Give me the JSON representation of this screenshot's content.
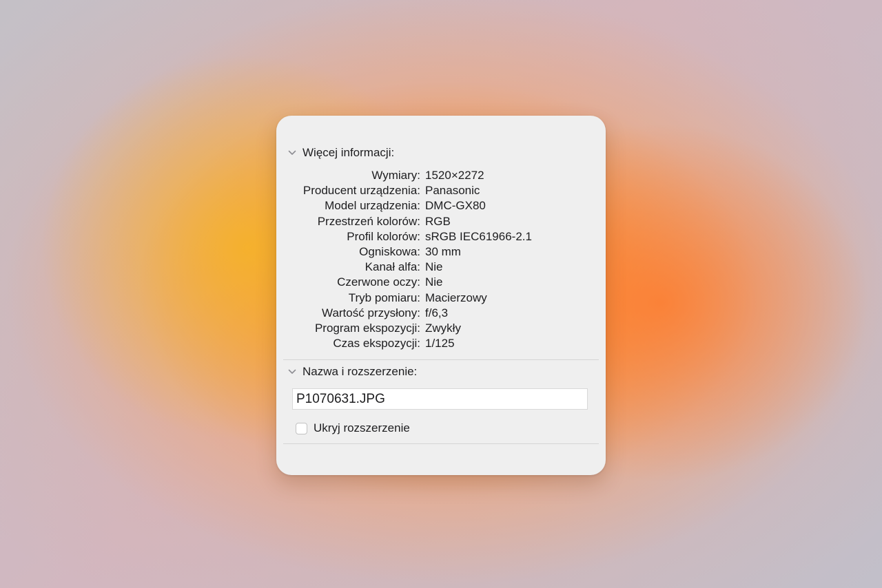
{
  "more_info": {
    "title": "Więcej informacji:",
    "rows": [
      {
        "label": "Wymiary:",
        "value": "1520×2272"
      },
      {
        "label": "Producent urządzenia:",
        "value": "Panasonic"
      },
      {
        "label": "Model urządzenia:",
        "value": "DMC-GX80"
      },
      {
        "label": "Przestrzeń kolorów:",
        "value": "RGB"
      },
      {
        "label": "Profil kolorów:",
        "value": "sRGB IEC61966-2.1"
      },
      {
        "label": "Ogniskowa:",
        "value": "30 mm"
      },
      {
        "label": "Kanał alfa:",
        "value": "Nie"
      },
      {
        "label": "Czerwone oczy:",
        "value": "Nie"
      },
      {
        "label": "Tryb pomiaru:",
        "value": "Macierzowy"
      },
      {
        "label": "Wartość przysłony:",
        "value": "f/6,3"
      },
      {
        "label": "Program ekspozycji:",
        "value": "Zwykły"
      },
      {
        "label": "Czas ekspozycji:",
        "value": "1/125"
      }
    ]
  },
  "name_extension": {
    "title": "Nazwa i rozszerzenie:",
    "filename": "P1070631.JPG",
    "hide_extension_label": "Ukryj rozszerzenie",
    "hide_extension_checked": false
  },
  "icons": {
    "disclosure": "chevron-down-icon"
  },
  "colors": {
    "panel_background": "#efefef",
    "text": "#1d1d1f",
    "divider": "#d5d5d5"
  }
}
